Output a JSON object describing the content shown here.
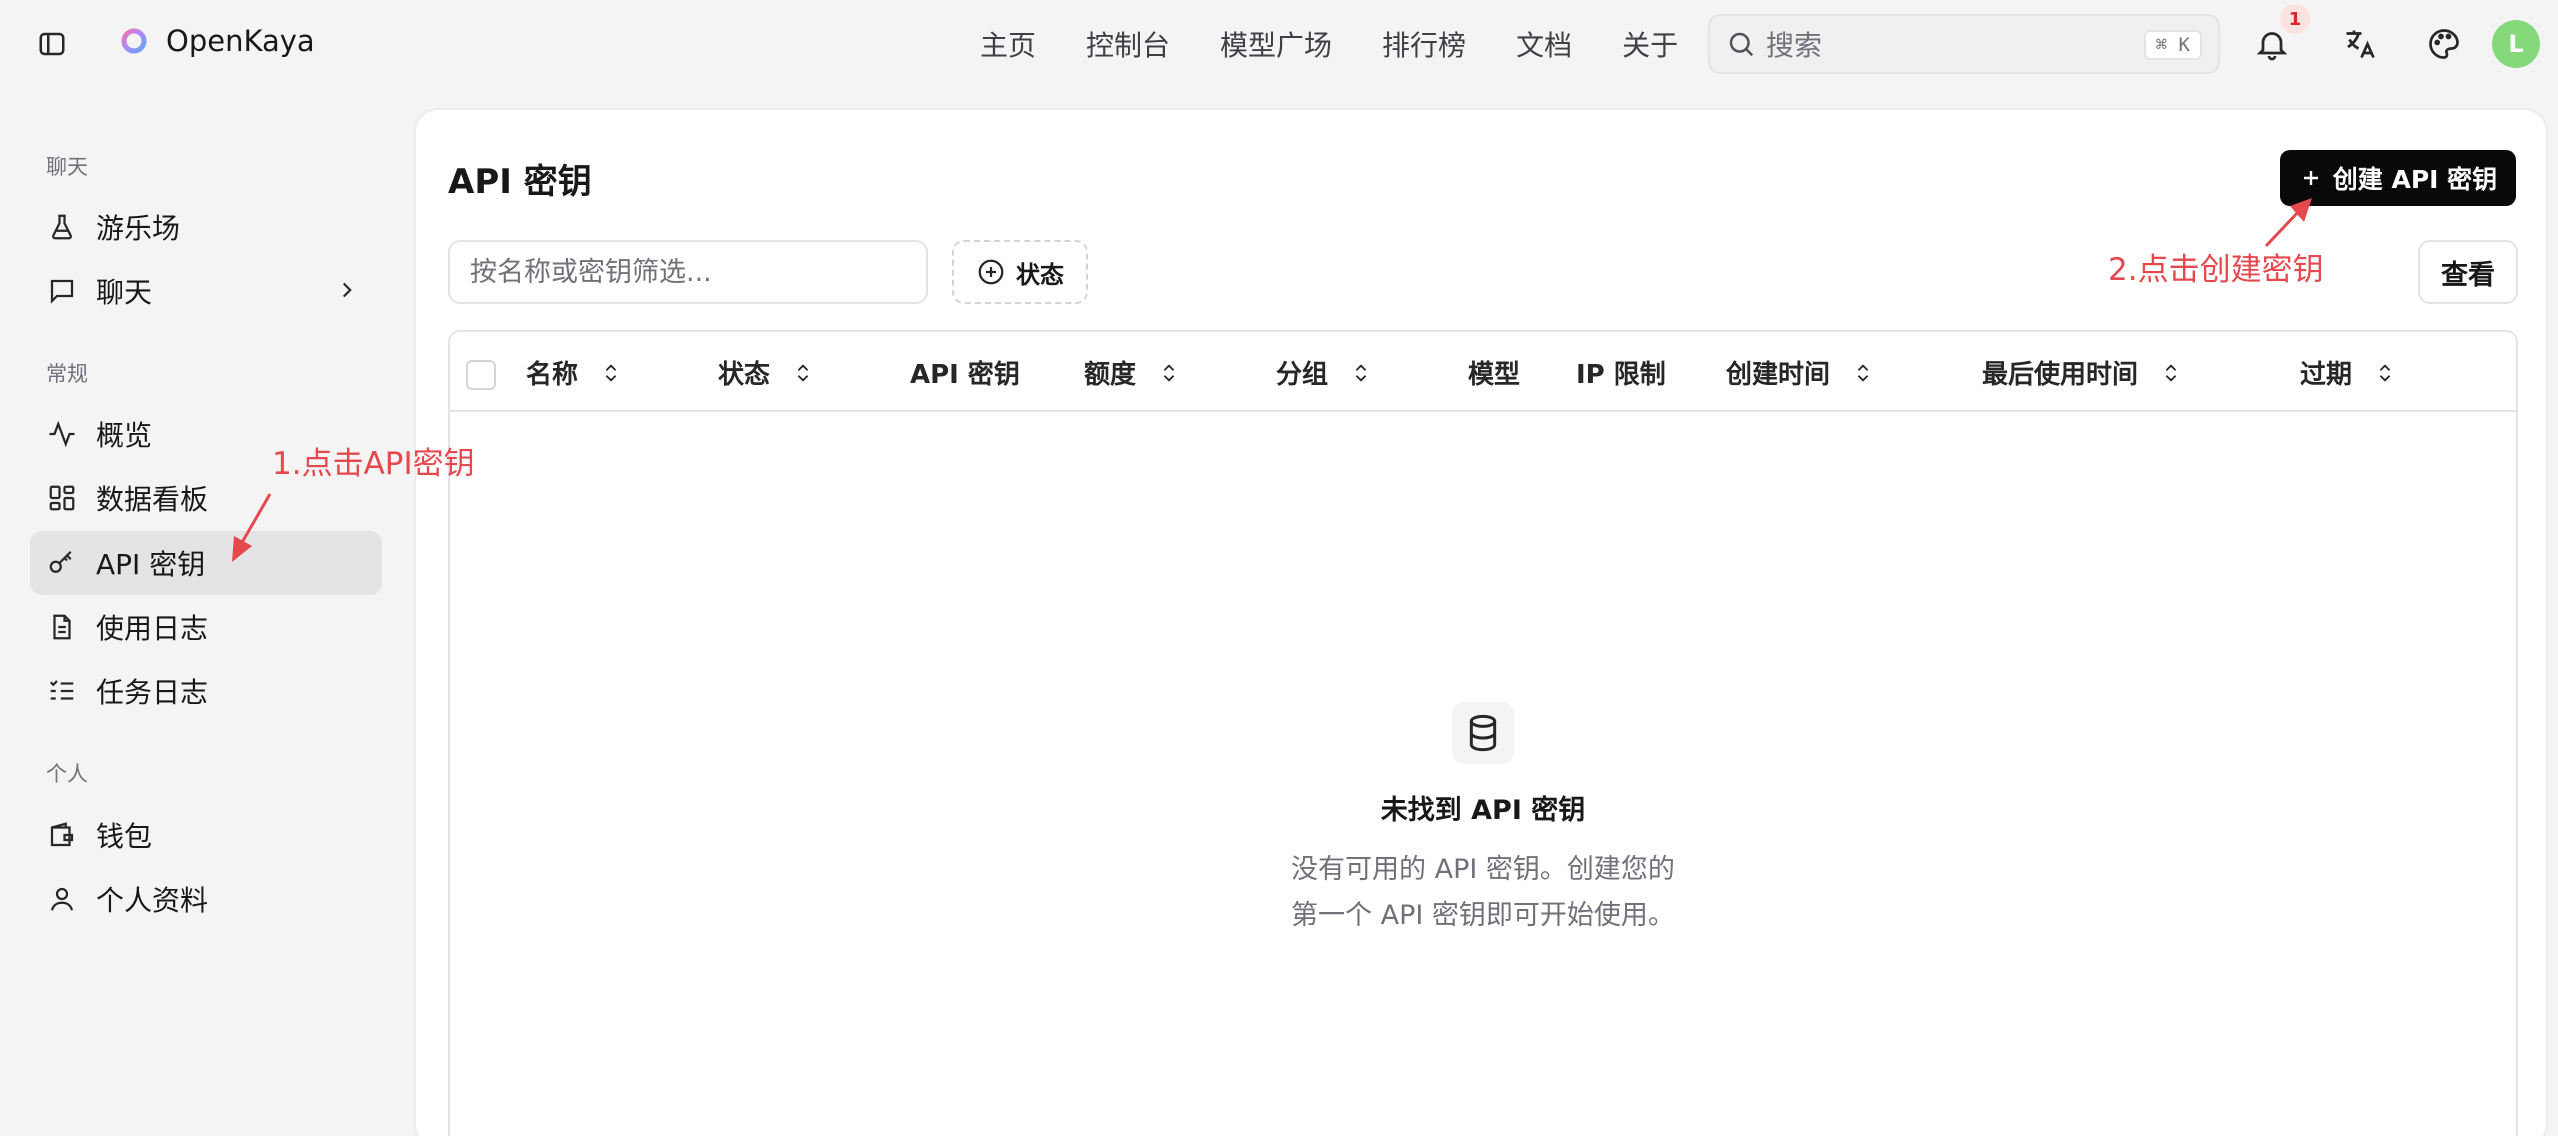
{
  "header": {
    "brand": "OpenKaya",
    "nav": [
      "主页",
      "控制台",
      "模型广场",
      "排行榜",
      "文档",
      "关于"
    ],
    "search_placeholder": "搜索",
    "search_shortcut": "⌘ K",
    "notification_count": "1",
    "avatar_letter": "L"
  },
  "sidebar": {
    "sections": [
      {
        "label": "聊天",
        "items": [
          {
            "label": "游乐场",
            "icon": "flask-icon"
          },
          {
            "label": "聊天",
            "icon": "message-icon"
          }
        ]
      },
      {
        "label": "常规",
        "items": [
          {
            "label": "概览",
            "icon": "activity-icon"
          },
          {
            "label": "数据看板",
            "icon": "dashboard-icon"
          },
          {
            "label": "API 密钥",
            "icon": "key-icon"
          },
          {
            "label": "使用日志",
            "icon": "file-text-icon"
          },
          {
            "label": "任务日志",
            "icon": "list-check-icon"
          }
        ]
      },
      {
        "label": "个人",
        "items": [
          {
            "label": "钱包",
            "icon": "wallet-icon"
          },
          {
            "label": "个人资料",
            "icon": "user-icon"
          }
        ]
      }
    ],
    "active": "API 密钥"
  },
  "main": {
    "title": "API 密钥",
    "create_button": "创建 API 密钥",
    "filter_placeholder": "按名称或密钥筛选...",
    "status_filter": "状态",
    "view_button": "查看",
    "columns": [
      "名称",
      "状态",
      "API 密钥",
      "额度",
      "分组",
      "模型",
      "IP 限制",
      "创建时间",
      "最后使用时间",
      "过期"
    ],
    "empty_title": "未找到 API 密钥",
    "empty_desc_line1": "没有可用的 API 密钥。创建您的",
    "empty_desc_line2": "第一个 API 密钥即可开始使用。"
  },
  "annotations": {
    "step1": "1.点击API密钥",
    "step2": "2.点击创建密钥",
    "color": "#e5484d"
  }
}
